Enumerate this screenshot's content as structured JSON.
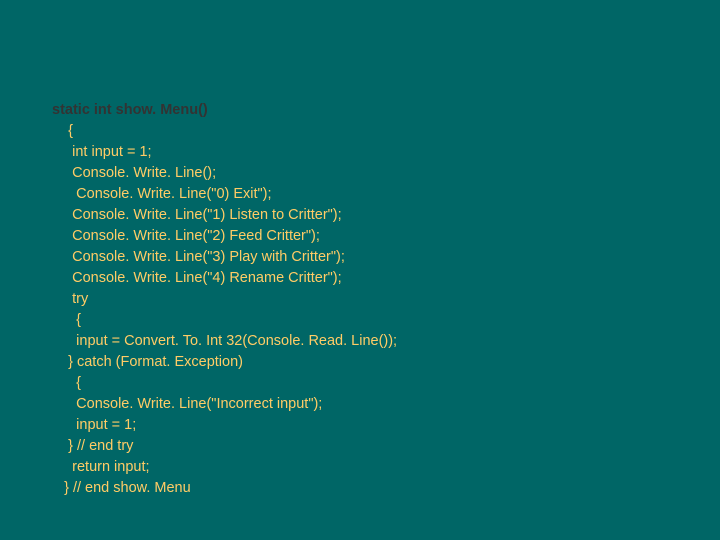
{
  "code": {
    "signature": "static int show. Menu()",
    "l1": "    {",
    "l2": "     int input = 1;",
    "l3": "     Console. Write. Line();",
    "l4": "      Console. Write. Line(\"0) Exit\");",
    "l5": "     Console. Write. Line(\"1) Listen to Critter\");",
    "l6": "     Console. Write. Line(\"2) Feed Critter\");",
    "l7": "     Console. Write. Line(\"3) Play with Critter\");",
    "l8": "     Console. Write. Line(\"4) Rename Critter\");",
    "l9": "     try",
    "l10": "      {",
    "l11": "      input = Convert. To. Int 32(Console. Read. Line());",
    "l12": "    } catch (Format. Exception)",
    "l13": "      {",
    "l14": "      Console. Write. Line(\"Incorrect input\");",
    "l15": "      input = 1;",
    "l16": "    } // end try",
    "l17": "     return input;",
    "l18": "   } // end show. Menu"
  }
}
